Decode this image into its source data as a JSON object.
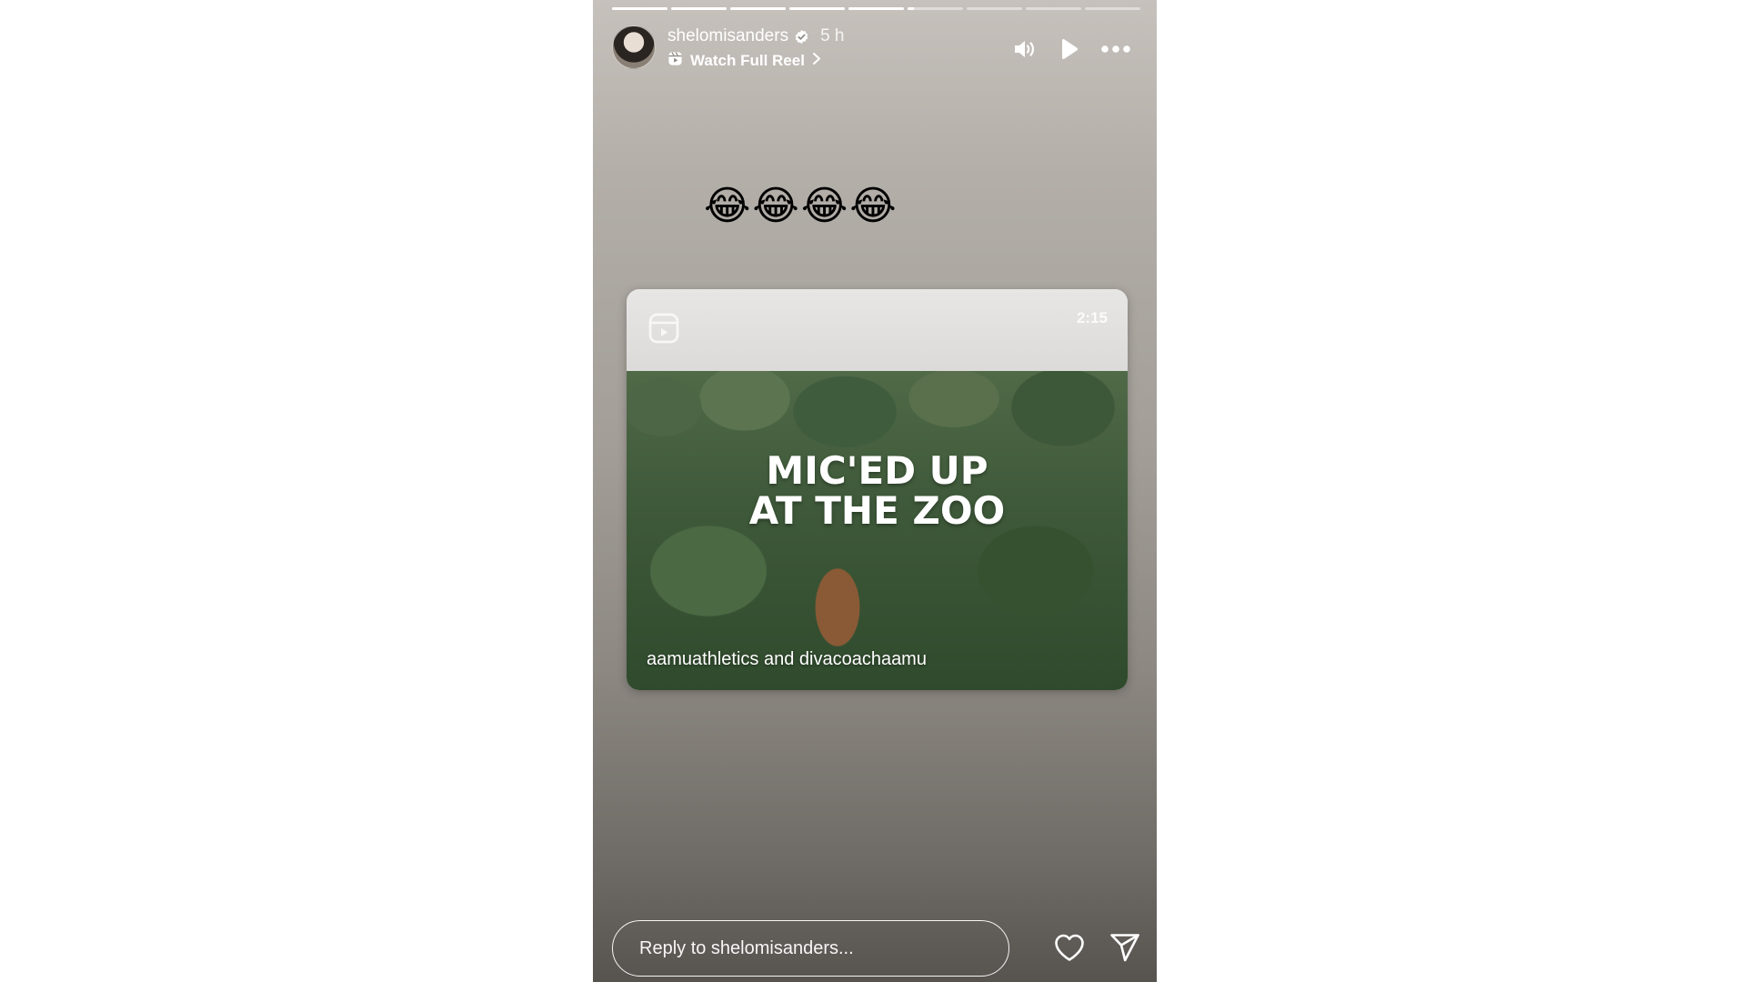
{
  "story": {
    "progress": {
      "segments": [
        1,
        1,
        1,
        1,
        1,
        0.12,
        0,
        0,
        0
      ]
    },
    "header": {
      "username": "shelomisanders",
      "verified": true,
      "time": "5 h",
      "reel_link_label": "Watch Full Reel",
      "reel_icon": "reels-icon",
      "chevron_icon": "chevron-right-icon",
      "controls": [
        "speaker-icon",
        "play-icon",
        "more-icon"
      ]
    },
    "emoji_text": "😂😂😂😂",
    "reel_card": {
      "title": "MIC'ED UP\nAT THE ZOO",
      "duration": "2:15",
      "caption": "aamuathletics and divacoachaamu",
      "icon": "reels-icon"
    },
    "reply": {
      "placeholder": "Reply to shelomisanders...",
      "actions": [
        "heart-icon",
        "send-icon"
      ]
    },
    "colors": {
      "text": "#ffffff",
      "background_top": "#c6c1bc",
      "background_bottom": "#57534f",
      "page_background": "#ffffff"
    }
  }
}
